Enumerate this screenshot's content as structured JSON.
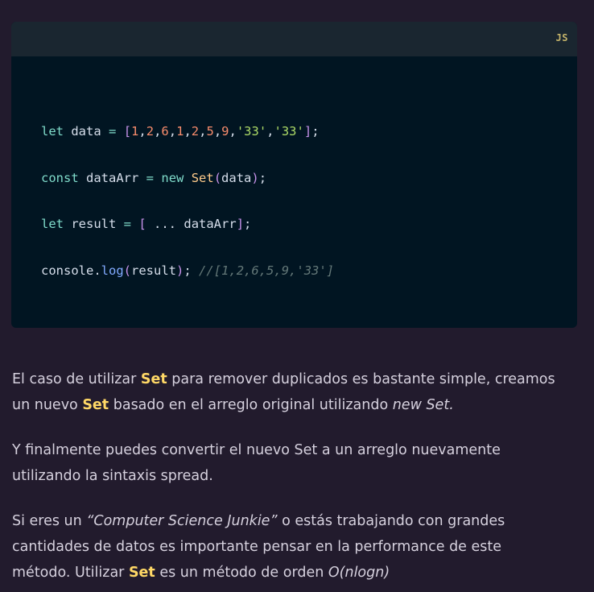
{
  "code_block": {
    "language": "JS",
    "lines": [
      {
        "parts": [
          "let",
          " data ",
          "=",
          " ",
          "[",
          "1",
          ",",
          "2",
          ",",
          "6",
          ",",
          "1",
          ",",
          "2",
          ",",
          "5",
          ",",
          "9",
          ",",
          "'33'",
          ",",
          "'33'",
          "]",
          ";"
        ]
      },
      {
        "parts": [
          "const",
          " dataArr ",
          "=",
          " ",
          "new",
          " ",
          "Set",
          "(",
          "data",
          ")",
          ";"
        ]
      },
      {
        "parts": [
          "let",
          " result ",
          "=",
          " ",
          "[",
          " ... ",
          "dataArr",
          "]",
          ";"
        ]
      },
      {
        "parts": [
          "console",
          ".",
          "log",
          "(",
          "result",
          ")",
          ";",
          " ",
          "//[1,2,6,5,9,'33']"
        ]
      }
    ]
  },
  "paragraphs": {
    "p1": {
      "a": "El caso de utilizar ",
      "set1": "Set",
      "b": " para remover duplicados es bastante simple, creamos",
      "c": "un nuevo ",
      "set2": "Set",
      "d": " basado en el arreglo original utilizando ",
      "e": "new Set."
    },
    "p2": {
      "line1": "Y finalmente puedes convertir el nuevo Set a un arreglo nuevamente",
      "line2": "utilizando la sintaxis spread."
    },
    "p3": {
      "a": "Si eres un ",
      "quote": "“Computer Science Junkie”",
      "b": " o estás trabajando con grandes",
      "line2": "cantidades de datos es importante pensar en la performance de este",
      "c": "método. Utilizar ",
      "set": "Set",
      "d": " es un método de orden ",
      "order": "O(nlogn)"
    }
  }
}
